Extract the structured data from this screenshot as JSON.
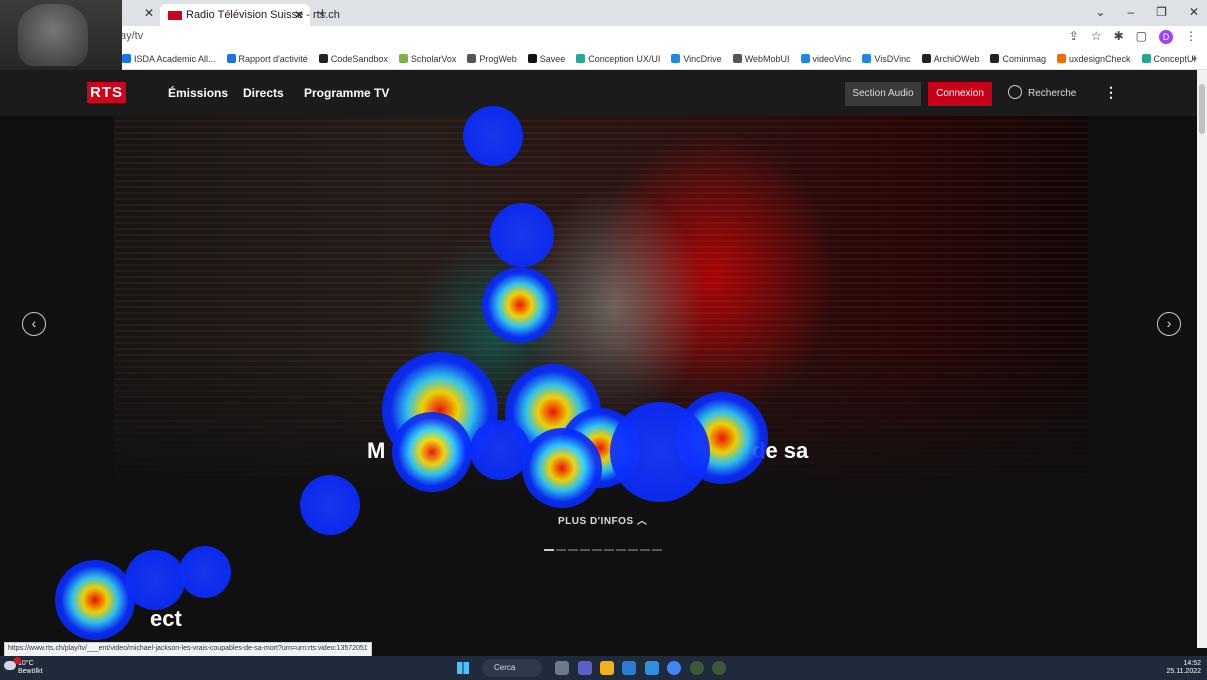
{
  "browser": {
    "tabs": [
      {
        "label": "Radio Télévision Suisse - rts.ch",
        "active": true
      }
    ],
    "url": "ay/tv",
    "bookmarks": [
      {
        "label": "ISDA Academic All...",
        "color": "#1a73e8"
      },
      {
        "label": "Rapport d'activité",
        "color": "#1a73e8"
      },
      {
        "label": "CodeSandbox",
        "color": "#222222"
      },
      {
        "label": "ScholarVox",
        "color": "#7cb342"
      },
      {
        "label": "ProgWeb",
        "color": "#555555"
      },
      {
        "label": "Savee",
        "color": "#111111"
      },
      {
        "label": "Conception UX/UI",
        "color": "#26a69a"
      },
      {
        "label": "VincDrive",
        "color": "#1e88e5"
      },
      {
        "label": "WebMobUI",
        "color": "#555555"
      },
      {
        "label": "videoVinc",
        "color": "#1e88e5"
      },
      {
        "label": "VisDVinc",
        "color": "#1e88e5"
      },
      {
        "label": "ArchiOWeb",
        "color": "#222222"
      },
      {
        "label": "Cominmag",
        "color": "#222222"
      },
      {
        "label": "uxdesignCheck",
        "color": "#ef6c00"
      },
      {
        "label": "ConceptUI",
        "color": "#26a69a"
      }
    ],
    "profile_initial": "D",
    "status_url": "https://www.rts.ch/play/tv/___ent/video/michael-jackson-les-vrais-coupables-de-sa-mort?urn=urn:rts:video:13572051"
  },
  "site": {
    "logo": "RTS",
    "nav": [
      "Émissions",
      "Directs",
      "Programme TV"
    ],
    "section_audio": "Section Audio",
    "login": "Connexion",
    "search": "Recherche",
    "hero_title_start": "M",
    "hero_title_end": "de sa",
    "more_info": "PLUS D'INFOS",
    "carousel_pages": 10,
    "carousel_active": 1,
    "section_title": "ect"
  },
  "taskbar": {
    "weather_temp": "10°C",
    "weather_desc": "Bewölkt",
    "search": "Cerca",
    "time": "14:52",
    "date": "25.11.2022"
  },
  "colors": {
    "brand_red": "#d0021b",
    "login_red": "#c60016"
  }
}
